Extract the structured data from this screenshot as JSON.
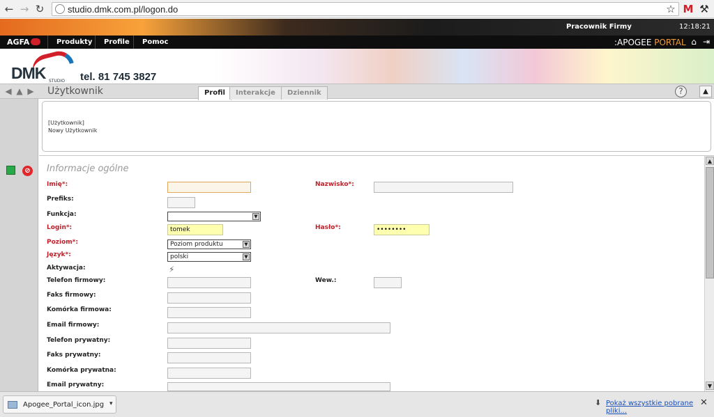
{
  "browser": {
    "url": "studio.dmk.com.pl/logon.do",
    "back_icon": "arrow-left-icon",
    "forward_icon": "arrow-right-icon",
    "reload_icon": "reload-icon",
    "star_icon": "star-icon",
    "gmail_icon": "gmail-icon",
    "wrench_icon": "wrench-icon"
  },
  "header": {
    "user_label": "Pracownik Firmy",
    "time": "12:18:21",
    "brand": "AGFA",
    "product_prefix": ":APOGEE",
    "product_suffix": " PORTAL",
    "menu": [
      "Produkty",
      "Profile",
      "Pomoc"
    ]
  },
  "logo": {
    "company": "DMK",
    "sub": "STUDIO",
    "phone": "tel. 81 745 3827"
  },
  "titlebar": {
    "title": "Użytkownik",
    "tabs": [
      {
        "label": "Profil",
        "active": true
      },
      {
        "label": "Interakcje",
        "active": false
      },
      {
        "label": "Dziennik",
        "active": false
      }
    ],
    "help": "?"
  },
  "info": {
    "line1": "[Użytkownik]",
    "line2": "Nowy Użytkownik"
  },
  "form": {
    "section_title": "Informacje ogólne",
    "fields": {
      "imie": {
        "label": "Imię*:",
        "value": ""
      },
      "nazwisko": {
        "label": "Nazwisko*:",
        "value": ""
      },
      "prefiks": {
        "label": "Prefiks:",
        "value": ""
      },
      "funkcja": {
        "label": "Funkcja:",
        "value": ""
      },
      "login": {
        "label": "Login*:",
        "value": "tomek"
      },
      "haslo": {
        "label": "Hasło*:",
        "value": "••••••••"
      },
      "poziom": {
        "label": "Poziom*:",
        "value": "Poziom produktu"
      },
      "jezyk": {
        "label": "Język*:",
        "value": "polski"
      },
      "aktywacja": {
        "label": "Aktywacja:"
      },
      "telefon_firmowy": {
        "label": "Telefon firmowy:",
        "value": ""
      },
      "wew": {
        "label": "Wew.:",
        "value": ""
      },
      "faks_firmowy": {
        "label": "Faks firmowy:",
        "value": ""
      },
      "komorka_firmowa": {
        "label": "Komórka firmowa:",
        "value": ""
      },
      "email_firmowy": {
        "label": "Email firmowy:",
        "value": ""
      },
      "telefon_prywatny": {
        "label": "Telefon prywatny:",
        "value": ""
      },
      "faks_prywatny": {
        "label": "Faks prywatny:",
        "value": ""
      },
      "komorka_prywatna": {
        "label": "Komórka prywatna:",
        "value": ""
      },
      "email_prywatny": {
        "label": "Email prywatny:",
        "value": ""
      }
    }
  },
  "downloads": {
    "file": "Apogee_Portal_icon.jpg",
    "show_all": "Pokaż wszystkie pobrane pliki..."
  },
  "colors": {
    "required_label": "#c0202a",
    "highlight_field": "#ffffb0",
    "accent_orange": "#f29b3e"
  }
}
